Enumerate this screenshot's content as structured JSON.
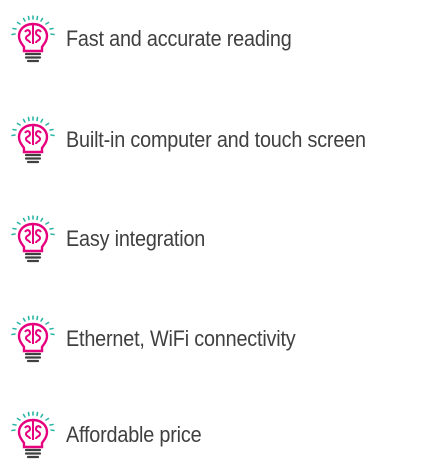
{
  "features": [
    {
      "label": "Fast and accurate reading",
      "icon": "brain-bulb-icon"
    },
    {
      "label": "Built-in computer and touch screen",
      "icon": "brain-bulb-icon"
    },
    {
      "label": "Easy integration",
      "icon": "brain-bulb-icon"
    },
    {
      "label": "Ethernet, WiFi connectivity",
      "icon": "brain-bulb-icon"
    },
    {
      "label": "Affordable price",
      "icon": "brain-bulb-icon"
    }
  ],
  "colors": {
    "accent": "#e6007e",
    "text": "#404040",
    "rays": "#2bb5a5"
  }
}
